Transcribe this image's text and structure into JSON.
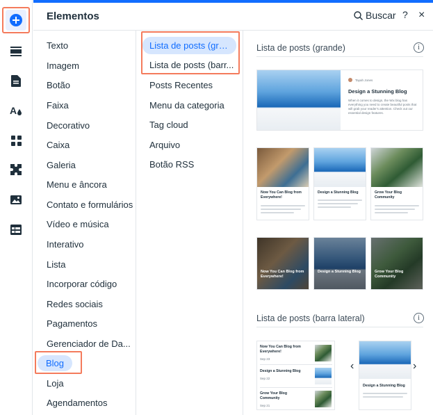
{
  "rail": {
    "items": [
      {
        "icon": "add-icon"
      },
      {
        "icon": "sections-icon"
      },
      {
        "icon": "pages-icon"
      },
      {
        "icon": "design-icon"
      },
      {
        "icon": "apps-icon"
      },
      {
        "icon": "business-icon"
      },
      {
        "icon": "media-icon"
      },
      {
        "icon": "cms-icon"
      }
    ]
  },
  "header": {
    "title": "Elementos",
    "search_label": "Buscar",
    "help_label": "?",
    "close_label": "×"
  },
  "categories": [
    "Texto",
    "Imagem",
    "Botão",
    "Faixa",
    "Decorativo",
    "Caixa",
    "Galeria",
    "Menu e âncora",
    "Contato e formulários",
    "Vídeo e música",
    "Interativo",
    "Lista",
    "Incorporar código",
    "Redes sociais",
    "Pagamentos",
    "Gerenciador de Da...",
    "Blog",
    "Loja",
    "Agendamentos"
  ],
  "selected_category": "Blog",
  "subcategories": [
    "Lista de posts (gran...",
    "Lista de posts (barr...",
    "Posts Recentes",
    "Menu da categoria",
    "Tag cloud",
    "Arquivo",
    "Botão RSS"
  ],
  "selected_subcategory": "Lista de posts (gran...",
  "preview": {
    "section1_title": "Lista de posts (grande)",
    "section2_title": "Lista de posts (barra lateral)",
    "info_label": "i",
    "large_card": {
      "author": "Tayah Jones",
      "title": "Design a Stunning Blog",
      "excerpt": "When it comes to design, the Wix blog has everything you need to create beautiful posts that will grab your reader's attention. Check out our essential design features."
    },
    "grid_cards": [
      {
        "title": "Now You Can Blog from Everywhere!"
      },
      {
        "title": "Design a Stunning Blog"
      },
      {
        "title": "Grow Your Blog Community"
      }
    ],
    "overlay_cards": [
      {
        "title": "Now You Can Blog from Everywhere!"
      },
      {
        "title": "Design a Stunning Blog"
      },
      {
        "title": "Grow Your Blog Community"
      }
    ],
    "sidebar_list": [
      {
        "title": "Now You Can Blog from Everywhere!",
        "date": "Sep 23"
      },
      {
        "title": "Design a Stunning Blog",
        "date": "Sep 22"
      },
      {
        "title": "Grow Your Blog Community",
        "date": "Sep 21"
      }
    ],
    "sidebar_card": {
      "title": "Design a Stunning Blog"
    }
  },
  "colors": {
    "accent": "#116dff",
    "selected_bg": "#d6e6fe",
    "highlight_frame": "#f47b5c"
  }
}
